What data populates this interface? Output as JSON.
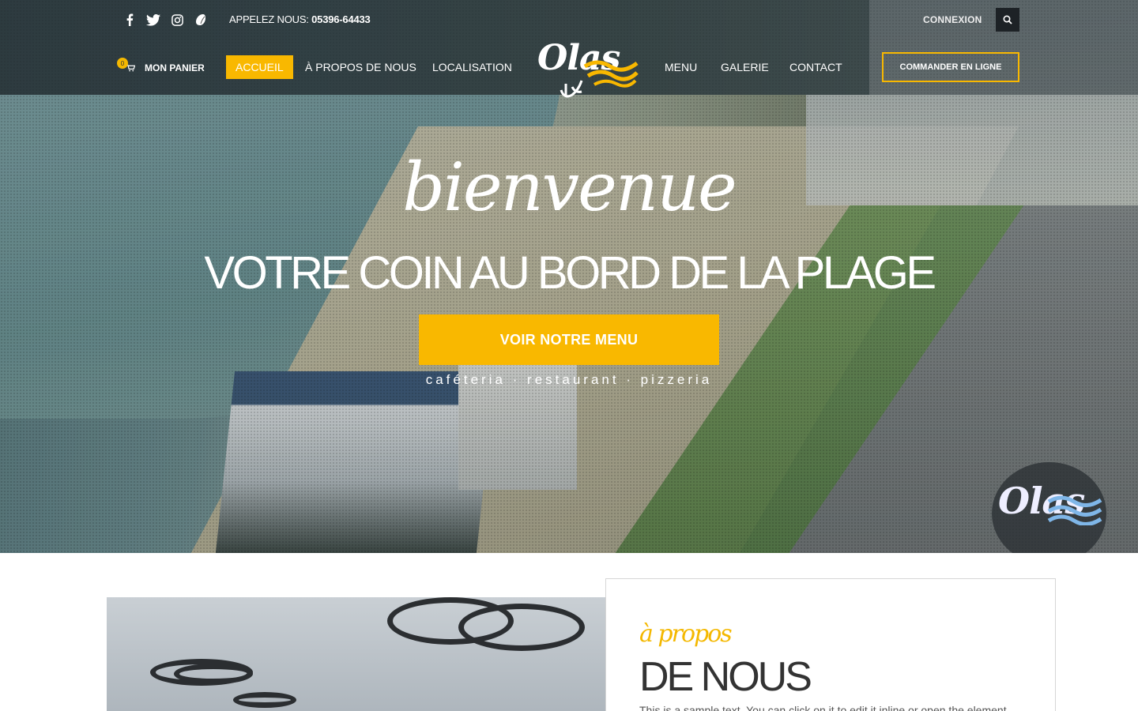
{
  "topbar": {
    "social_icons": [
      "facebook-icon",
      "twitter-icon",
      "instagram-icon",
      "tripadvisor-icon"
    ],
    "phone_label": "APPELEZ NOUS:",
    "phone_number": "05396-64433",
    "login_label": "CONNEXION",
    "search_icon": "search-icon"
  },
  "cart": {
    "count": "0",
    "label": "MON PANIER"
  },
  "nav": {
    "items": [
      "ACCUEIL",
      "À PROPOS DE NOUS",
      "LOCALISATION",
      "MENU",
      "GALERIE",
      "CONTACT"
    ],
    "active": "ACCUEIL"
  },
  "logo": {
    "word": "Olas"
  },
  "order_button": "COMMANDER EN LIGNE",
  "hero": {
    "welcome": "bienvenue",
    "headline": "VOTRE COIN AU BORD DE LA PLAGE",
    "cta": "VOIR NOTRE MENU",
    "tagline": "caféteria · restaurant · pizzeria",
    "watermark": "Olas"
  },
  "about": {
    "kicker": "à propos",
    "title": "DE NOUS",
    "text": "This is a sample text. You can click on it to edit it inline or open the element"
  },
  "colors": {
    "accent": "#f9b800",
    "topbar": "#2d383e",
    "dark": "#1d2226"
  }
}
